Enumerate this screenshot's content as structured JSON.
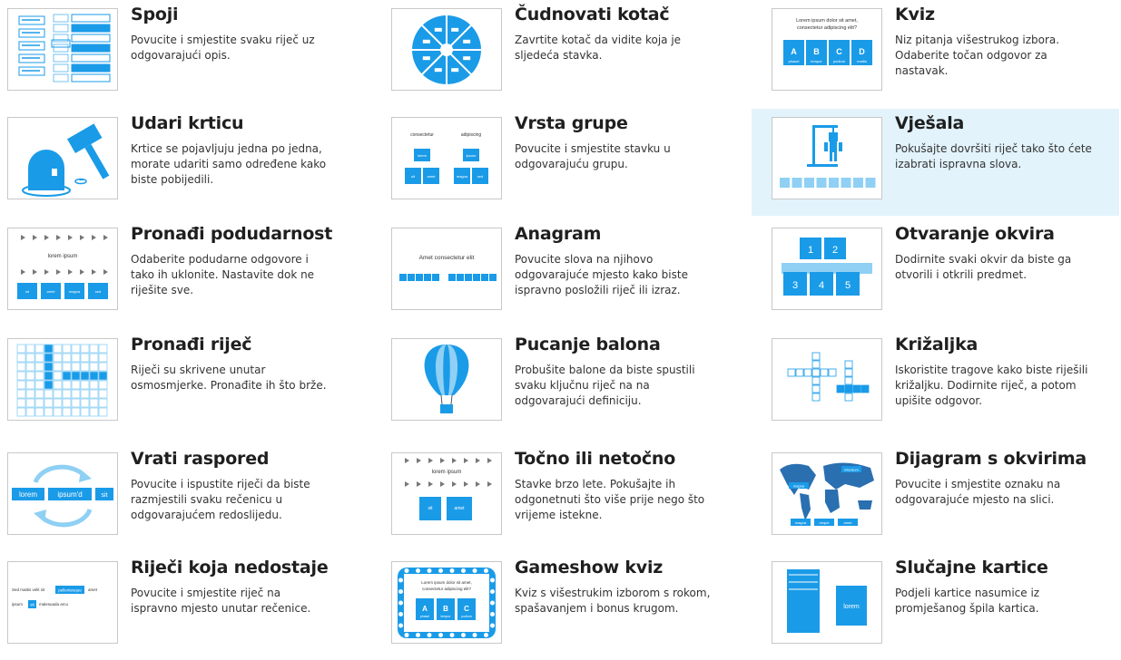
{
  "cards": [
    {
      "title": "Spoji",
      "desc": "Povucite i smjestite svaku riječ uz odgovarajući opis.",
      "thumb": "match-up-icon"
    },
    {
      "title": "Čudnovati kotač",
      "desc": "Zavrtite kotač da vidite koja je sljedeća stavka.",
      "thumb": "spin-wheel-icon"
    },
    {
      "title": "Kviz",
      "desc": "Niz pitanja višestrukog izbora. Odaberite točan odgovor za nastavak.",
      "thumb": "quiz-icon",
      "thumb_text": {
        "q1": "Lorem ipsum dolor sit amet,",
        "q2": "consectetur adipiscing elit?",
        "a": "A",
        "b": "B",
        "c": "C",
        "d": "D",
        "aw": "phasel",
        "bw": "tempor",
        "cw": "podium",
        "dw": "mattis"
      }
    },
    {
      "title": "Udari krticu",
      "desc": "Krtice se pojavljuju jedna po jedna, morate udariti samo određene kako biste pobijedili.",
      "thumb": "whack-a-mole-icon"
    },
    {
      "title": "Vrsta grupe",
      "desc": "Povucite i smjestite stavku u odgovarajuću grupu.",
      "thumb": "group-sort-icon",
      "thumb_text": {
        "g1": "consectetur",
        "g2": "adipiscing",
        "i1": "lorem",
        "i2": "ipsum",
        "i3": "sit",
        "i4": "amet",
        "i5": "magna",
        "i6": "sed"
      }
    },
    {
      "title": "Vješala",
      "desc": "Pokušajte dovršiti riječ tako što ćete izabrati ispravna slova.",
      "thumb": "hangman-icon",
      "highlight": true
    },
    {
      "title": "Pronađi podudarnost",
      "desc": "Odaberite podudarne odgovore i tako ih uklonite. Nastavite dok ne riješite sve.",
      "thumb": "find-match-icon",
      "thumb_text": {
        "w": "lorem ipsum",
        "t1": "sit",
        "t2": "amet",
        "t3": "magna",
        "t4": "sed"
      }
    },
    {
      "title": "Anagram",
      "desc": "Povucite slova na njihovo odgovarajuće mjesto kako biste ispravno posložili riječ ili izraz.",
      "thumb": "anagram-icon",
      "thumb_text": {
        "w": "Amet consectetur elit"
      }
    },
    {
      "title": "Otvaranje okvira",
      "desc": "Dodirnite svaki okvir da biste ga otvorili i otkrili predmet.",
      "thumb": "open-box-icon",
      "thumb_text": {
        "n1": "1",
        "n2": "2",
        "n3": "3",
        "n4": "4",
        "n5": "5"
      }
    },
    {
      "title": "Pronađi riječ",
      "desc": "Riječi su skrivene unutar osmosmjerke. Pronađite ih što brže.",
      "thumb": "wordsearch-icon"
    },
    {
      "title": "Pucanje balona",
      "desc": "Probušite balone da biste spustili svaku ključnu riječ na na odgovarajući definiciju.",
      "thumb": "balloon-pop-icon"
    },
    {
      "title": "Križaljka",
      "desc": "Iskoristite tragove kako biste riješili križaljku. Dodirnite riječ, a potom upišite odgovor.",
      "thumb": "crossword-icon"
    },
    {
      "title": "Vrati raspored",
      "desc": "Povucite i ispustite riječi da biste razmjestili svaku rečenicu u odgovarajućem redoslijedu.",
      "thumb": "unjumble-icon",
      "thumb_text": {
        "w1": "lorem",
        "w2": "ipsum'd",
        "w3": "sit"
      }
    },
    {
      "title": "Točno ili netočno",
      "desc": "Stavke brzo lete. Pokušajte ih odgonetnuti što više prije nego što vrijeme istekne.",
      "thumb": "true-false-icon",
      "thumb_text": {
        "w": "lorem ipsum",
        "t1": "sit",
        "t2": "amet"
      }
    },
    {
      "title": "Dijagram s okvirima",
      "desc": "Povucite i smjestite oznaku na odgovarajuće mjesto na slici.",
      "thumb": "labelled-diagram-icon",
      "thumb_text": {
        "l1": "magna",
        "l2": "neque",
        "l3": "amet",
        "p1": "interdum",
        "p2": "magna"
      }
    },
    {
      "title": "Riječi koja nedostaje",
      "desc": "Povucite i smjestite riječ na ispravno mjesto unutar rečenice.",
      "thumb": "missing-word-icon",
      "thumb_text": {
        "a": "Sed mattis velit sit",
        "b": "pellentesque",
        "c": "amet",
        "d": "ipsum",
        "e": "sit",
        "f": "malesuada arcu"
      }
    },
    {
      "title": "Gameshow kviz",
      "desc": "Kviz s višestrukim izborom s rokom, spašavanjem i bonus krugom.",
      "thumb": "gameshow-quiz-icon",
      "thumb_text": {
        "q1": "Lorem ipsum dolor sit amet,",
        "q2": "consectetur adipiscing elit?",
        "a": "A",
        "b": "B",
        "c": "C",
        "aw": "phasel",
        "bw": "tempor",
        "cw": "podium"
      }
    },
    {
      "title": "Slučajne kartice",
      "desc": "Podjeli kartice nasumice iz promješanog špila kartica.",
      "thumb": "random-cards-icon",
      "thumb_text": {
        "w": "lorem"
      }
    }
  ]
}
